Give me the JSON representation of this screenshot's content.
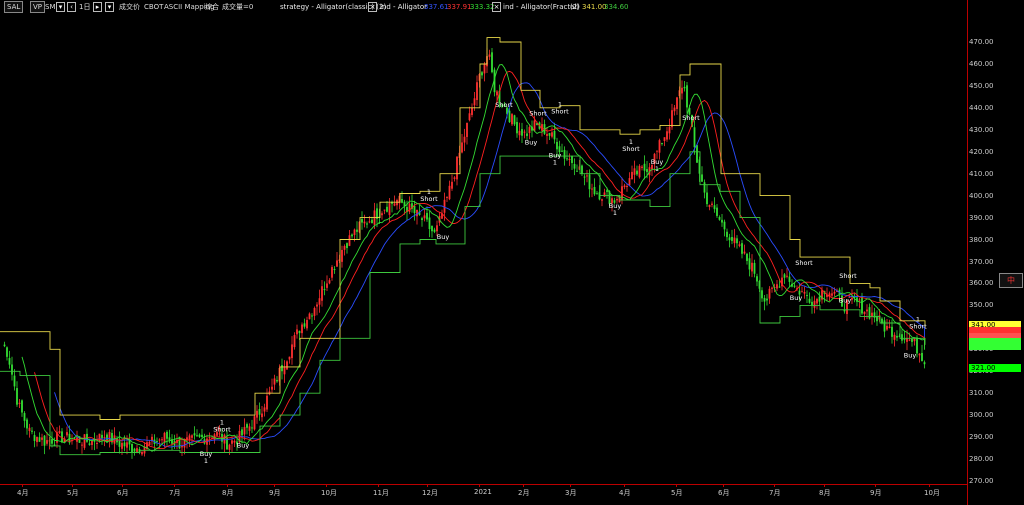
{
  "toolbar": {
    "symbol": "SAL",
    "vp": "VP",
    "sm": "SM",
    "interval": "1日",
    "chart_type": "成交价",
    "exchange": "CBOT",
    "mapping": "ASCII Mapping",
    "summary": "综合",
    "volume": "成交量=0",
    "strategy_label": "strategy - Alligator(classic) (2)",
    "ind1_label": "ind - Alligator",
    "ind1_vals": [
      "337.61",
      "337.91",
      "333.32"
    ],
    "ind2_label": "ind - Alligator(Fractal)",
    "ind2_params": "(2)",
    "ind2_vals": [
      "341.00",
      "334.60"
    ]
  },
  "colors": {
    "jaw": "#2a4dff",
    "teeth": "#ff2020",
    "lips": "#33dd33",
    "fractal_up": "#e8d84a",
    "fractal_dn": "#3ec83e",
    "candle_up": "#ff3030",
    "candle_dn": "#33e033"
  },
  "side_button": "中",
  "chart_data": {
    "type": "candlestick",
    "y_ticks": [
      "470.00",
      "460.00",
      "450.00",
      "440.00",
      "430.00",
      "420.00",
      "410.00",
      "400.00",
      "390.00",
      "380.00",
      "370.00",
      "360.00",
      "350.00",
      "340.00",
      "330.00",
      "320.00",
      "310.00",
      "300.00",
      "290.00",
      "280.00",
      "270.00"
    ],
    "ylim": [
      270,
      475
    ],
    "x_ticks": [
      "4月",
      "5月",
      "6月",
      "7月",
      "8月",
      "9月",
      "10月",
      "11月",
      "12月",
      "2021",
      "2月",
      "3月",
      "4月",
      "5月",
      "6月",
      "7月",
      "8月",
      "9月",
      "10月"
    ],
    "price_tags": [
      {
        "value": 341.0,
        "text": "341.00",
        "color": "#ffff33"
      },
      {
        "value": 338.4,
        "text": "",
        "color": "#ff3030"
      },
      {
        "value": 335.5,
        "text": "",
        "color": "#ff5050"
      },
      {
        "value": 333.3,
        "text": "",
        "color": "#33ff33"
      },
      {
        "value": 331.5,
        "text": "",
        "color": "#33ff33"
      },
      {
        "value": 321.5,
        "text": "321.00",
        "color": "#00ff00"
      }
    ],
    "anchors": [
      [
        0,
        335
      ],
      [
        8,
        328
      ],
      [
        18,
        305
      ],
      [
        30,
        292
      ],
      [
        45,
        288
      ],
      [
        60,
        290
      ],
      [
        75,
        289
      ],
      [
        90,
        288
      ],
      [
        105,
        291
      ],
      [
        120,
        287
      ],
      [
        135,
        285
      ],
      [
        150,
        287
      ],
      [
        165,
        290
      ],
      [
        178,
        287
      ],
      [
        190,
        288
      ],
      [
        205,
        290
      ],
      [
        215,
        292
      ],
      [
        228,
        287
      ],
      [
        240,
        290
      ],
      [
        255,
        298
      ],
      [
        270,
        310
      ],
      [
        285,
        325
      ],
      [
        300,
        340
      ],
      [
        315,
        350
      ],
      [
        330,
        365
      ],
      [
        345,
        378
      ],
      [
        358,
        385
      ],
      [
        372,
        390
      ],
      [
        385,
        395
      ],
      [
        398,
        398
      ],
      [
        412,
        393
      ],
      [
        425,
        388
      ],
      [
        435,
        382
      ],
      [
        448,
        400
      ],
      [
        460,
        420
      ],
      [
        472,
        440
      ],
      [
        480,
        455
      ],
      [
        488,
        465
      ],
      [
        495,
        448
      ],
      [
        505,
        440
      ],
      [
        515,
        432
      ],
      [
        525,
        428
      ],
      [
        535,
        432
      ],
      [
        545,
        430
      ],
      [
        555,
        425
      ],
      [
        565,
        418
      ],
      [
        575,
        415
      ],
      [
        585,
        408
      ],
      [
        595,
        402
      ],
      [
        605,
        400
      ],
      [
        615,
        398
      ],
      [
        625,
        405
      ],
      [
        635,
        410
      ],
      [
        645,
        412
      ],
      [
        655,
        418
      ],
      [
        665,
        428
      ],
      [
        675,
        440
      ],
      [
        683,
        452
      ],
      [
        688,
        440
      ],
      [
        695,
        420
      ],
      [
        705,
        400
      ],
      [
        715,
        392
      ],
      [
        725,
        385
      ],
      [
        735,
        378
      ],
      [
        745,
        372
      ],
      [
        755,
        365
      ],
      [
        765,
        352
      ],
      [
        775,
        358
      ],
      [
        785,
        365
      ],
      [
        795,
        358
      ],
      [
        805,
        355
      ],
      [
        815,
        352
      ],
      [
        825,
        358
      ],
      [
        835,
        355
      ],
      [
        845,
        350
      ],
      [
        855,
        352
      ],
      [
        865,
        348
      ],
      [
        875,
        345
      ],
      [
        885,
        340
      ],
      [
        895,
        338
      ],
      [
        905,
        336
      ],
      [
        915,
        332
      ],
      [
        925,
        325
      ]
    ],
    "fractal_up": [
      [
        0,
        338
      ],
      [
        20,
        338
      ],
      [
        50,
        330
      ],
      [
        60,
        300
      ],
      [
        100,
        298
      ],
      [
        120,
        300
      ],
      [
        180,
        300
      ],
      [
        240,
        300
      ],
      [
        255,
        310
      ],
      [
        280,
        322
      ],
      [
        300,
        335
      ],
      [
        340,
        380
      ],
      [
        360,
        390
      ],
      [
        380,
        397
      ],
      [
        400,
        401
      ],
      [
        420,
        402
      ],
      [
        440,
        410
      ],
      [
        460,
        440
      ],
      [
        480,
        460
      ],
      [
        487,
        472
      ],
      [
        500,
        470
      ],
      [
        520,
        470
      ],
      [
        521,
        448
      ],
      [
        540,
        440
      ],
      [
        560,
        441
      ],
      [
        580,
        430
      ],
      [
        600,
        430
      ],
      [
        620,
        428
      ],
      [
        640,
        430
      ],
      [
        660,
        432
      ],
      [
        680,
        455
      ],
      [
        690,
        460
      ],
      [
        720,
        460
      ],
      [
        721,
        410
      ],
      [
        760,
        400
      ],
      [
        790,
        380
      ],
      [
        800,
        372
      ],
      [
        830,
        372
      ],
      [
        850,
        360
      ],
      [
        870,
        358
      ],
      [
        880,
        352
      ],
      [
        900,
        343
      ],
      [
        925,
        340
      ]
    ],
    "fractal_dn": [
      [
        0,
        320
      ],
      [
        20,
        318
      ],
      [
        50,
        286
      ],
      [
        60,
        282
      ],
      [
        100,
        283
      ],
      [
        140,
        284
      ],
      [
        180,
        283
      ],
      [
        240,
        283
      ],
      [
        260,
        295
      ],
      [
        280,
        300
      ],
      [
        300,
        310
      ],
      [
        320,
        325
      ],
      [
        340,
        335
      ],
      [
        370,
        365
      ],
      [
        400,
        378
      ],
      [
        420,
        380
      ],
      [
        436,
        378
      ],
      [
        460,
        378
      ],
      [
        465,
        395
      ],
      [
        480,
        410
      ],
      [
        500,
        418
      ],
      [
        520,
        418
      ],
      [
        540,
        418
      ],
      [
        560,
        418
      ],
      [
        580,
        410
      ],
      [
        600,
        400
      ],
      [
        620,
        398
      ],
      [
        650,
        395
      ],
      [
        670,
        410
      ],
      [
        690,
        420
      ],
      [
        700,
        405
      ],
      [
        720,
        402
      ],
      [
        740,
        390
      ],
      [
        760,
        342
      ],
      [
        780,
        345
      ],
      [
        800,
        350
      ],
      [
        820,
        348
      ],
      [
        840,
        348
      ],
      [
        860,
        345
      ],
      [
        880,
        342
      ],
      [
        900,
        335
      ],
      [
        925,
        332
      ]
    ],
    "signals": [
      {
        "x": 222,
        "y": 292,
        "text": "Short",
        "num": "1",
        "dir": "up"
      },
      {
        "x": 206,
        "y": 285,
        "text": "Buy",
        "num": "1",
        "dir": "dn"
      },
      {
        "x": 243,
        "y": 289,
        "text": "Buy",
        "num": "",
        "dir": "dn"
      },
      {
        "x": 429,
        "y": 397,
        "text": "Short",
        "num": "1",
        "dir": "up"
      },
      {
        "x": 443,
        "y": 384,
        "text": "Buy",
        "num": "",
        "dir": "dn"
      },
      {
        "x": 504,
        "y": 440,
        "text": "Short",
        "num": "",
        "dir": "up"
      },
      {
        "x": 538,
        "y": 436,
        "text": "Short",
        "num": "",
        "dir": "up"
      },
      {
        "x": 560,
        "y": 437,
        "text": "Short",
        "num": "1",
        "dir": "up"
      },
      {
        "x": 531,
        "y": 427,
        "text": "Buy",
        "num": "",
        "dir": "dn"
      },
      {
        "x": 555,
        "y": 421,
        "text": "Buy",
        "num": "1",
        "dir": "dn"
      },
      {
        "x": 615,
        "y": 398,
        "text": "Buy",
        "num": "1",
        "dir": "dn"
      },
      {
        "x": 631,
        "y": 420,
        "text": "Short",
        "num": "1",
        "dir": "up"
      },
      {
        "x": 657,
        "y": 418,
        "text": "Buy",
        "num": "1",
        "dir": "dn"
      },
      {
        "x": 691,
        "y": 434,
        "text": "Short",
        "num": "",
        "dir": "up"
      },
      {
        "x": 804,
        "y": 368,
        "text": "Short",
        "num": "",
        "dir": "up"
      },
      {
        "x": 796,
        "y": 356,
        "text": "Buy",
        "num": "",
        "dir": "dn"
      },
      {
        "x": 848,
        "y": 362,
        "text": "Short",
        "num": "",
        "dir": "up"
      },
      {
        "x": 845,
        "y": 355,
        "text": "Buy",
        "num": "",
        "dir": "dn"
      },
      {
        "x": 918,
        "y": 339,
        "text": "Short",
        "num": "1",
        "dir": "up"
      },
      {
        "x": 910,
        "y": 330,
        "text": "Buy",
        "num": "",
        "dir": "dn"
      }
    ]
  }
}
